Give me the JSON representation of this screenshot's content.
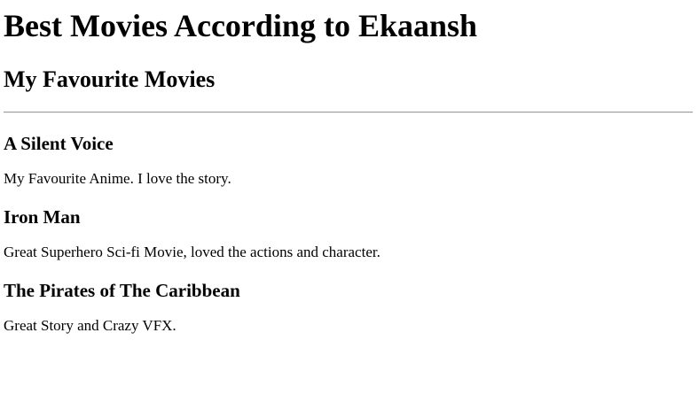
{
  "page": {
    "title": "Best Movies According to Ekaansh",
    "subtitle": "My Favourite Movies"
  },
  "movies": [
    {
      "name": "A Silent Voice",
      "description": "My Favourite Anime. I love the story."
    },
    {
      "name": "Iron Man",
      "description": "Great Superhero Sci-fi Movie, loved the actions and character."
    },
    {
      "name": "The Pirates of The Caribbean",
      "description": "Great Story and Crazy VFX."
    }
  ]
}
